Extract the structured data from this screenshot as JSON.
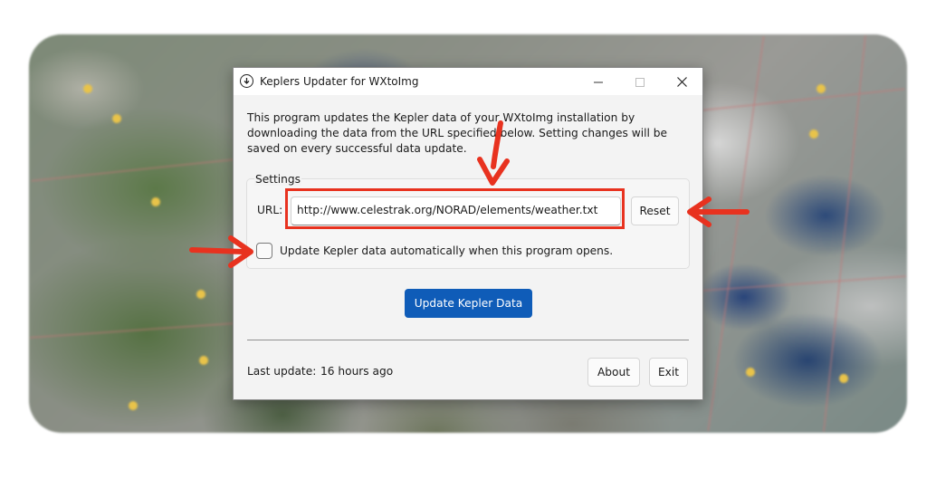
{
  "window": {
    "title": "Keplers Updater for WXtoImg",
    "controls": {
      "minimize_icon": "minimize-icon",
      "maximize_icon": "maximize-icon",
      "close_icon": "close-icon"
    }
  },
  "description": "This program updates the Kepler data of your WXtoImg installation by downloading the data from  the URL specified below. Setting changes will be saved on every successful data update.",
  "settings": {
    "group_label": "Settings",
    "url_label": "URL:",
    "url_value": "http://www.celestrak.org/NORAD/elements/weather.txt",
    "reset_label": "Reset",
    "auto_update_label": "Update Kepler data automatically when this program opens.",
    "auto_update_checked": false
  },
  "actions": {
    "update_label": "Update Kepler Data",
    "about_label": "About",
    "exit_label": "Exit"
  },
  "status": {
    "last_update_label": "Last update:",
    "last_update_value": "16 hours ago"
  },
  "colors": {
    "accent": "#0f5cb8",
    "annotation": "#e8321f"
  }
}
